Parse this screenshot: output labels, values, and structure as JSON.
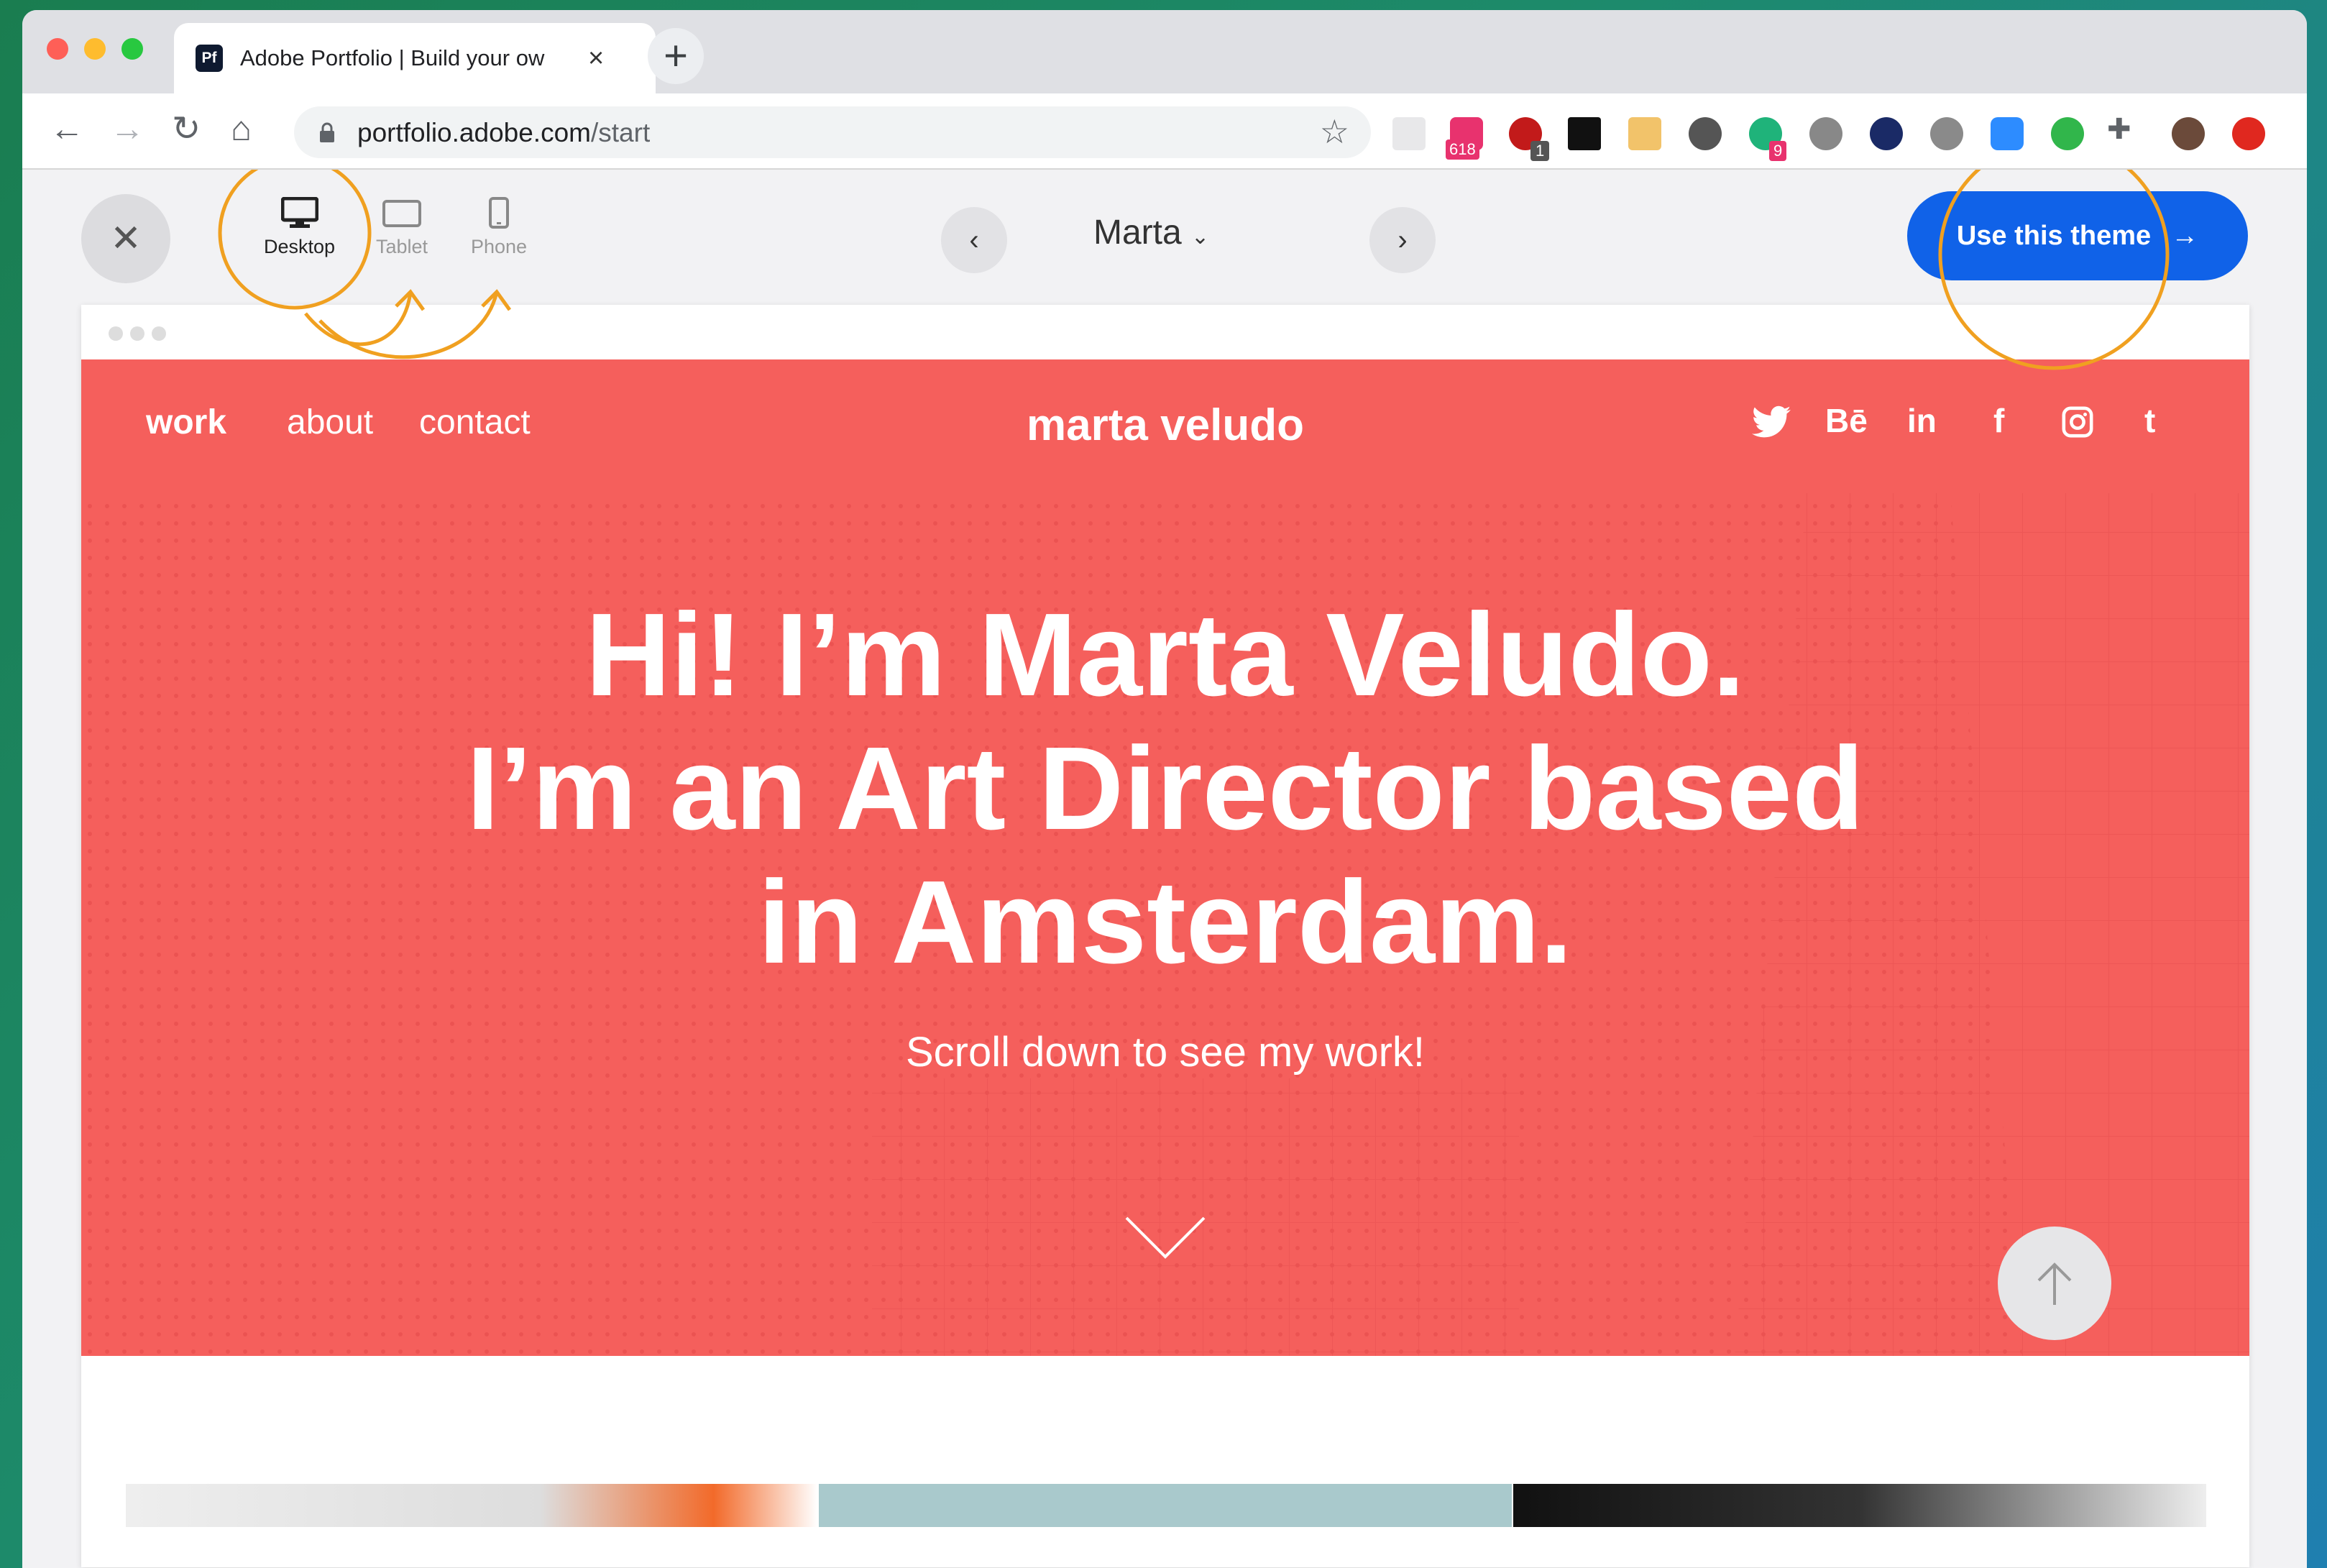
{
  "browser": {
    "tab_title": "Adobe Portfolio | Build your ow",
    "favicon_text": "Pf",
    "url_host": "portfolio.adobe.com",
    "url_path": "/start",
    "extension_badges": [
      "618",
      "1",
      "9"
    ]
  },
  "editor": {
    "devices": [
      {
        "label": "Desktop",
        "icon": "desktop-icon",
        "active": true
      },
      {
        "label": "Tablet",
        "icon": "tablet-icon",
        "active": false
      },
      {
        "label": "Phone",
        "icon": "phone-icon",
        "active": false
      }
    ],
    "theme_name": "Marta",
    "use_theme_label": "Use this theme",
    "use_theme_arrow": "→"
  },
  "site": {
    "nav": [
      "work",
      "about",
      "contact"
    ],
    "brand": "marta veludo",
    "social": [
      "twitter-icon",
      "Bē",
      "in",
      "f",
      "instagram-icon",
      "t"
    ],
    "headline": [
      "Hi! I’m Marta Veludo.",
      "I’m an Art Director based",
      "in Amsterdam."
    ],
    "subheadline": "Scroll down to see my work!"
  },
  "colors": {
    "hero_bg": "#f55f5c",
    "accent_blue": "#1062e8",
    "annotation_orange": "#f0a020"
  }
}
